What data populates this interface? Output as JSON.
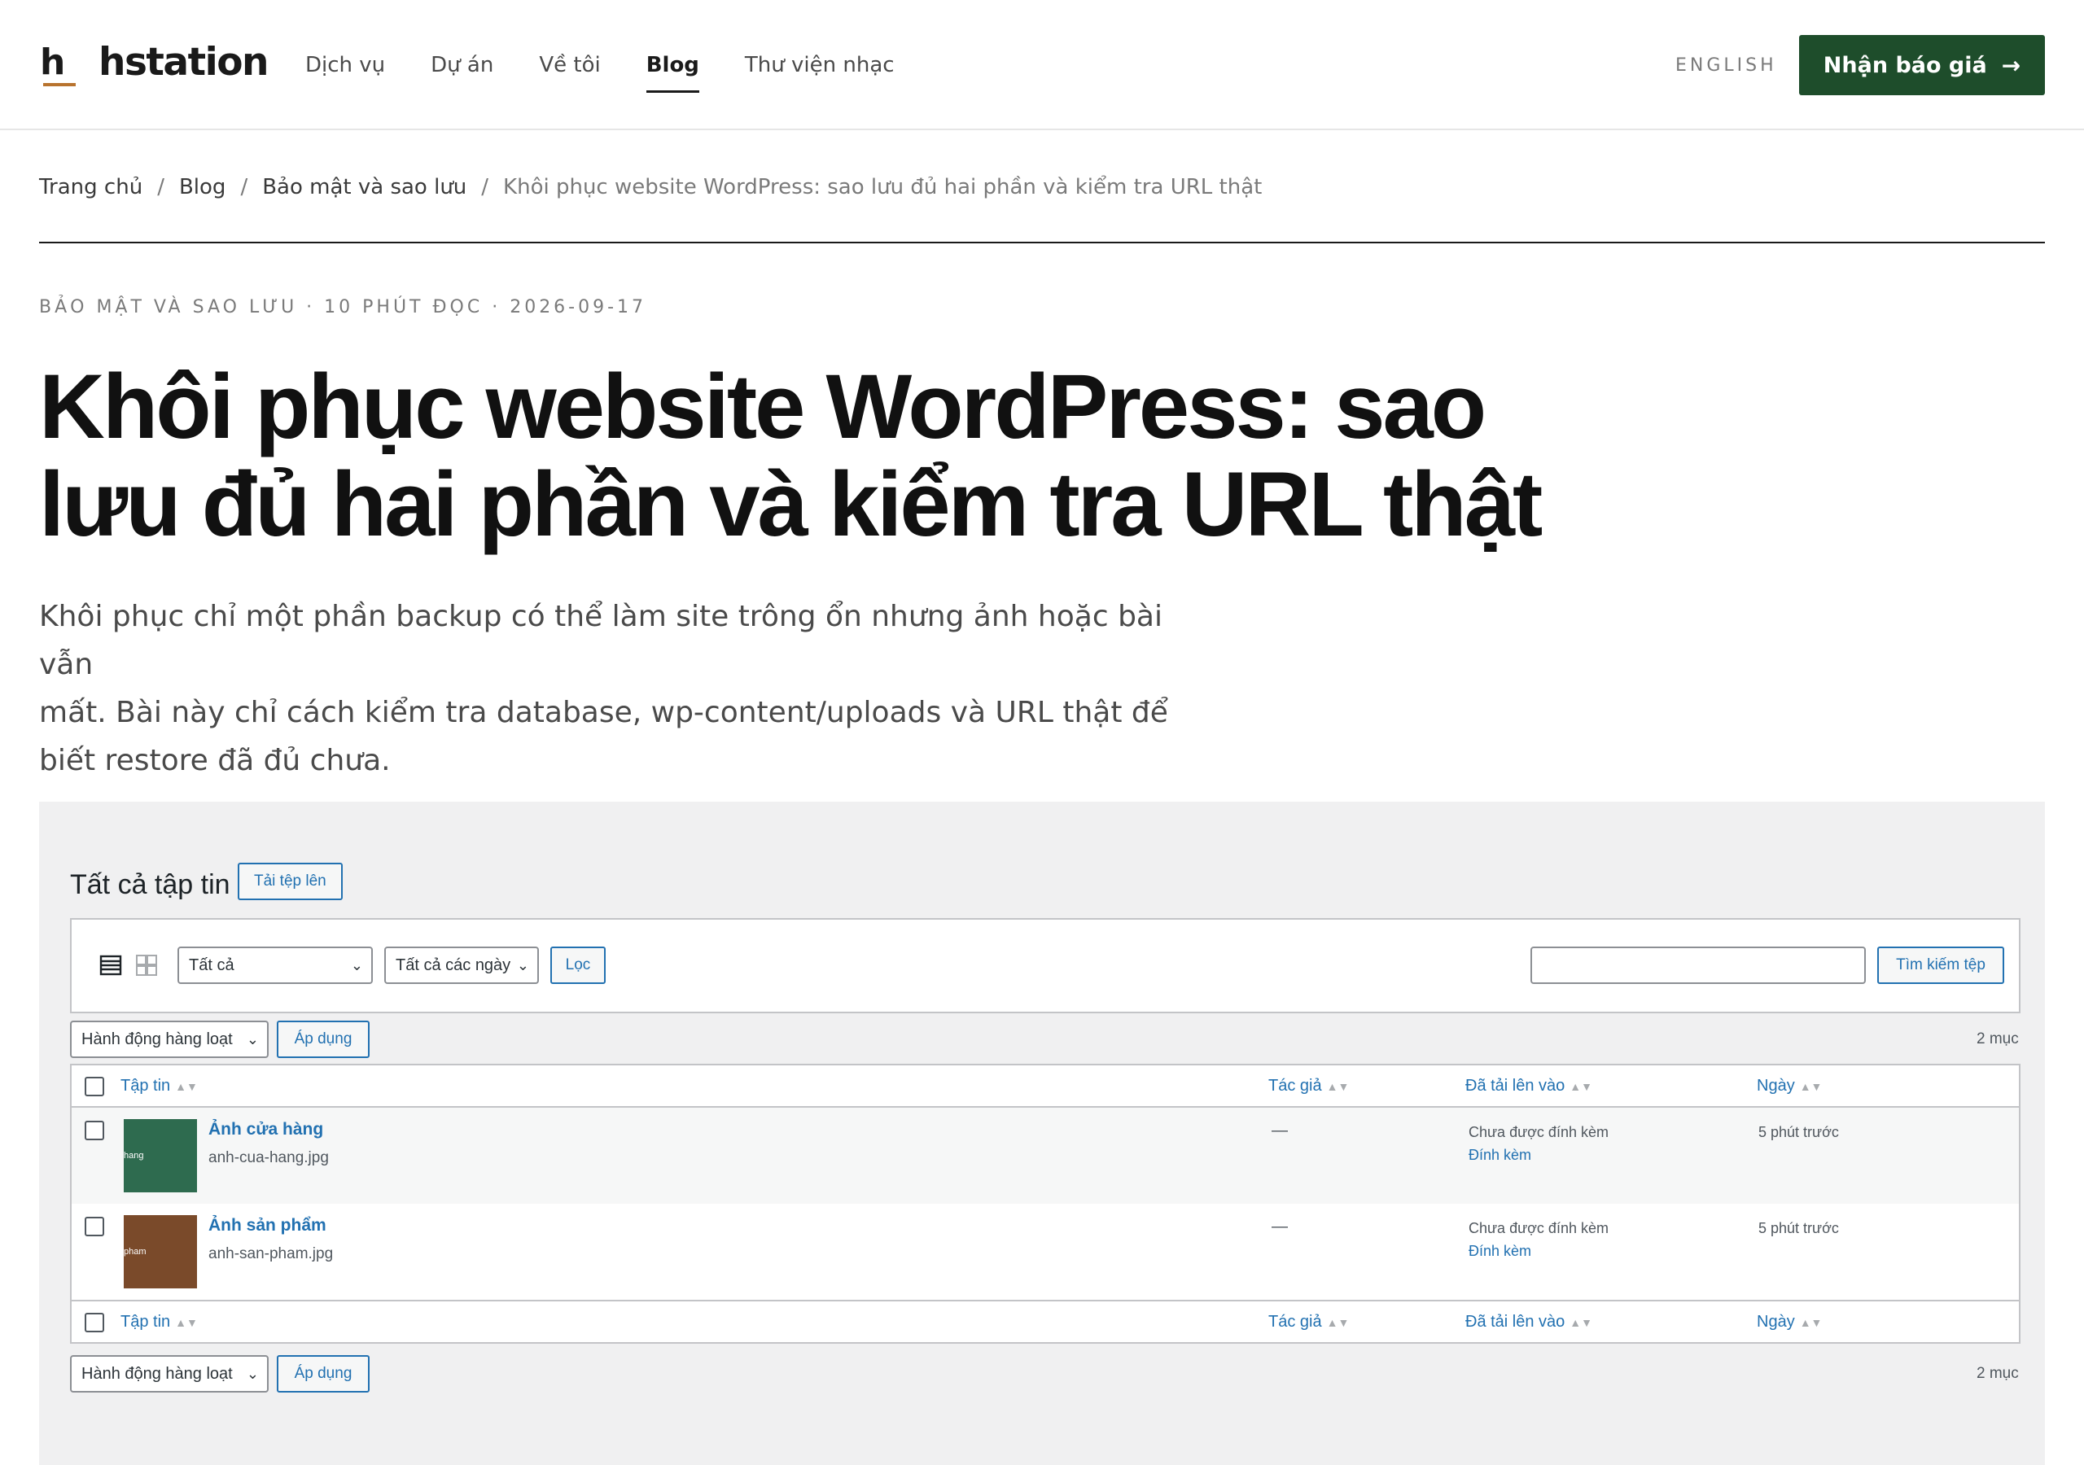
{
  "site": {
    "logo_mark": "h",
    "logo_text": "hstation",
    "nav": [
      {
        "label": "Dịch vụ"
      },
      {
        "label": "Dự án"
      },
      {
        "label": "Về tôi"
      },
      {
        "label": "Blog"
      },
      {
        "label": "Thư viện nhạc"
      }
    ],
    "active_nav": "Blog",
    "language_link": "ENGLISH",
    "cta_label": "Nhận báo giá",
    "cta_icon": "arrow-right-icon",
    "accent_color": "#1e4d2b"
  },
  "breadcrumb": [
    {
      "label": "Trang chủ"
    },
    {
      "label": "Blog"
    },
    {
      "label": "Bảo mật và sao lưu"
    },
    {
      "label": "Khôi phục website WordPress: sao lưu đủ hai phần và kiểm tra URL thật"
    }
  ],
  "breadcrumb_separator": "/",
  "article": {
    "meta": "BẢO MẬT VÀ SAO LƯU · 10 PHÚT ĐỌC · 2026-09-17",
    "title_line1": "Khôi phục website WordPress: sao",
    "title_line2": "lưu đủ hai phần và kiểm tra URL thật",
    "lede_line1": "Khôi phục chỉ một phần backup có thể làm site trông ổn nhưng ảnh hoặc bài vẫn",
    "lede_line2": "mất. Bài này chỉ cách kiểm tra database, wp-content/uploads và URL thật để",
    "lede_line3": "biết restore đã đủ chưa."
  },
  "media_library": {
    "heading": "Tất cả tập tin",
    "upload_button": "Tải tệp lên",
    "filter_type": "Tất cả",
    "filter_date": "Tất cả các ngày",
    "filter_button": "Lọc",
    "search_value": "",
    "search_button": "Tìm kiếm tệp",
    "bulk_action": "Hành động hàng loạt",
    "apply_button": "Áp dụng",
    "item_count": "2 mục",
    "columns": [
      "Tập tin",
      "Tác giả",
      "Đã tải lên vào",
      "Ngày"
    ],
    "rows": [
      {
        "thumb_label": "hang",
        "thumb_color": "#2e6b4f",
        "title": "Ảnh cửa hàng",
        "filename": "anh-cua-hang.jpg",
        "author": "—",
        "attached": "Chưa được đính kèm",
        "attach_link": "Đính kèm",
        "date": "5 phút trước"
      },
      {
        "thumb_label": "pham",
        "thumb_color": "#7a4a2a",
        "title": "Ảnh sản phẩm",
        "filename": "anh-san-pham.jpg",
        "author": "—",
        "attached": "Chưa được đính kèm",
        "attach_link": "Đính kèm",
        "date": "5 phút trước"
      }
    ]
  }
}
